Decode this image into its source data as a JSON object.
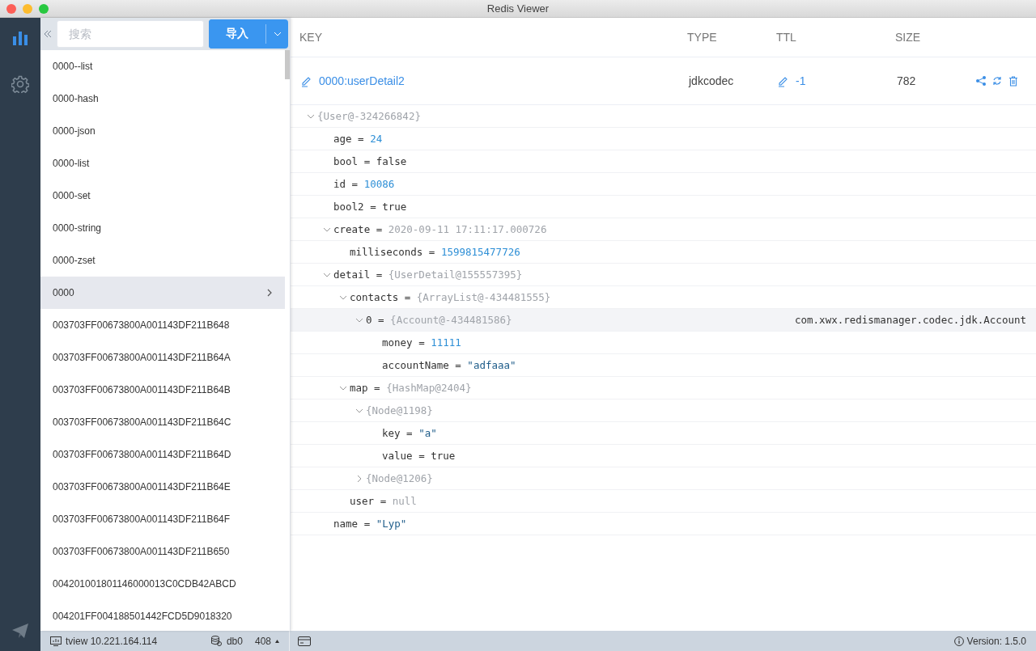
{
  "window": {
    "title": "Redis Viewer"
  },
  "nav_items": [
    {
      "selected": true
    },
    {
      "selected": false
    }
  ],
  "search": {
    "placeholder": "搜索"
  },
  "import_button": "导入",
  "keys": [
    {
      "label": "0000--list",
      "selected": false
    },
    {
      "label": "0000-hash",
      "selected": false
    },
    {
      "label": "0000-json",
      "selected": false
    },
    {
      "label": "0000-list",
      "selected": false
    },
    {
      "label": "0000-set",
      "selected": false
    },
    {
      "label": "0000-string",
      "selected": false
    },
    {
      "label": "0000-zset",
      "selected": false
    },
    {
      "label": "0000",
      "selected": true
    },
    {
      "label": "003703FF00673800A001143DF211B648",
      "selected": false
    },
    {
      "label": "003703FF00673800A001143DF211B64A",
      "selected": false
    },
    {
      "label": "003703FF00673800A001143DF211B64B",
      "selected": false
    },
    {
      "label": "003703FF00673800A001143DF211B64C",
      "selected": false
    },
    {
      "label": "003703FF00673800A001143DF211B64D",
      "selected": false
    },
    {
      "label": "003703FF00673800A001143DF211B64E",
      "selected": false
    },
    {
      "label": "003703FF00673800A001143DF211B64F",
      "selected": false
    },
    {
      "label": "003703FF00673800A001143DF211B650",
      "selected": false
    },
    {
      "label": "004201001801146000013C0CDB42ABCD",
      "selected": false
    },
    {
      "label": "004201FF004188501442FCD5D9018320",
      "selected": false
    }
  ],
  "detail": {
    "columns": [
      "KEY",
      "TYPE",
      "TTL",
      "SIZE"
    ],
    "key_row": {
      "key": "0000:userDetail2",
      "type": "jdkcodec",
      "ttl": "-1",
      "size": "782"
    },
    "tree": {
      "value": "{User@-324266842}",
      "kind": "ref",
      "expanded": true,
      "selected": false,
      "children": [
        {
          "name": "age =",
          "value": "24",
          "kind": "number",
          "selected": false
        },
        {
          "name": "bool =",
          "value": "false",
          "kind": "plain",
          "selected": false
        },
        {
          "name": "id =",
          "value": "10086",
          "kind": "number",
          "selected": false
        },
        {
          "name": "bool2 =",
          "value": "true",
          "kind": "plain",
          "selected": false
        },
        {
          "name": "create =",
          "value": "2020-09-11 17:11:17.000726",
          "kind": "ref",
          "expanded": true,
          "selected": false,
          "children": [
            {
              "name": "milliseconds =",
              "value": "1599815477726",
              "kind": "number",
              "selected": false
            }
          ]
        },
        {
          "name": "detail =",
          "value": "{UserDetail@155557395}",
          "kind": "ref",
          "expanded": true,
          "selected": false,
          "children": [
            {
              "name": "contacts =",
              "value": "{ArrayList@-434481555}",
              "kind": "ref",
              "expanded": true,
              "selected": false,
              "children": [
                {
                  "name": "0 =",
                  "value": "{Account@-434481586}",
                  "kind": "ref",
                  "expanded": true,
                  "selected": true,
                  "note": "com.xwx.redismanager.codec.jdk.Account",
                  "children": [
                    {
                      "name": "money =",
                      "value": "11111",
                      "kind": "number",
                      "selected": false
                    },
                    {
                      "name": "accountName =",
                      "value": "\"adfaaa\"",
                      "kind": "string",
                      "selected": false
                    }
                  ]
                }
              ]
            },
            {
              "name": "map =",
              "value": "{HashMap@2404}",
              "kind": "ref",
              "expanded": true,
              "selected": false,
              "children": [
                {
                  "value": "{Node@1198}",
                  "kind": "ref",
                  "expanded": true,
                  "selected": false,
                  "children": [
                    {
                      "name": "key =",
                      "value": "\"a\"",
                      "kind": "string",
                      "selected": false
                    },
                    {
                      "name": "value =",
                      "value": "true",
                      "kind": "plain",
                      "selected": false
                    }
                  ]
                },
                {
                  "value": "{Node@1206}",
                  "kind": "ref",
                  "expanded": false,
                  "selected": false
                }
              ]
            },
            {
              "name": "user =",
              "value": "null",
              "kind": "ref",
              "selected": false
            }
          ]
        },
        {
          "name": "name =",
          "value": "\"Lyp\"",
          "kind": "string",
          "selected": false
        }
      ]
    }
  },
  "status_bar": {
    "connection": "tview 10.221.164.114",
    "database": "db0",
    "count": "408",
    "version": "Version: 1.5.0"
  }
}
